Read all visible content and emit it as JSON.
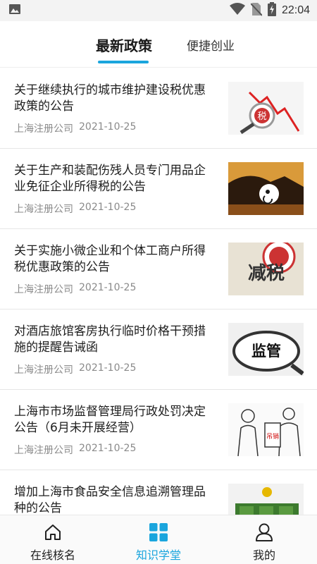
{
  "status_bar": {
    "time": "22:04",
    "icons": [
      "image-icon",
      "wifi-icon",
      "no-sim-icon",
      "battery-charging-icon"
    ]
  },
  "tabs": [
    {
      "label": "最新政策",
      "active": true
    },
    {
      "label": "便捷创业",
      "active": false
    }
  ],
  "news": [
    {
      "title": "关于继续执行的城市维护建设税优惠政策的公告",
      "source": "上海注册公司",
      "date": "2021-10-25",
      "thumb_text": "税"
    },
    {
      "title": "关于生产和装配伤残人员专门用品企业免征企业所得税的公告",
      "source": "上海注册公司",
      "date": "2021-10-25",
      "thumb_text": ""
    },
    {
      "title": "关于实施小微企业和个体工商户所得税优惠政策的公告",
      "source": "上海注册公司",
      "date": "2021-10-25",
      "thumb_text": "减税"
    },
    {
      "title": "对酒店旅馆客房执行临时价格干预措施的提醒告诫函",
      "source": "上海注册公司",
      "date": "2021-10-25",
      "thumb_text": "监管"
    },
    {
      "title": "上海市市场监督管理局行政处罚决定公告（6月未开展经营）",
      "source": "上海注册公司",
      "date": "2021-10-25",
      "thumb_text": "吊销"
    },
    {
      "title": "增加上海市食品安全信息追溯管理品种的公告",
      "source": "",
      "date": "",
      "thumb_text": ""
    }
  ],
  "bottom_nav": [
    {
      "label": "在线核名",
      "icon": "home-icon",
      "active": false
    },
    {
      "label": "知识学堂",
      "icon": "grid-icon",
      "active": true
    },
    {
      "label": "我的",
      "icon": "user-icon",
      "active": false
    }
  ],
  "colors": {
    "accent": "#1aa5dd",
    "text": "#1e1e1e",
    "meta": "#8a8a8a"
  }
}
